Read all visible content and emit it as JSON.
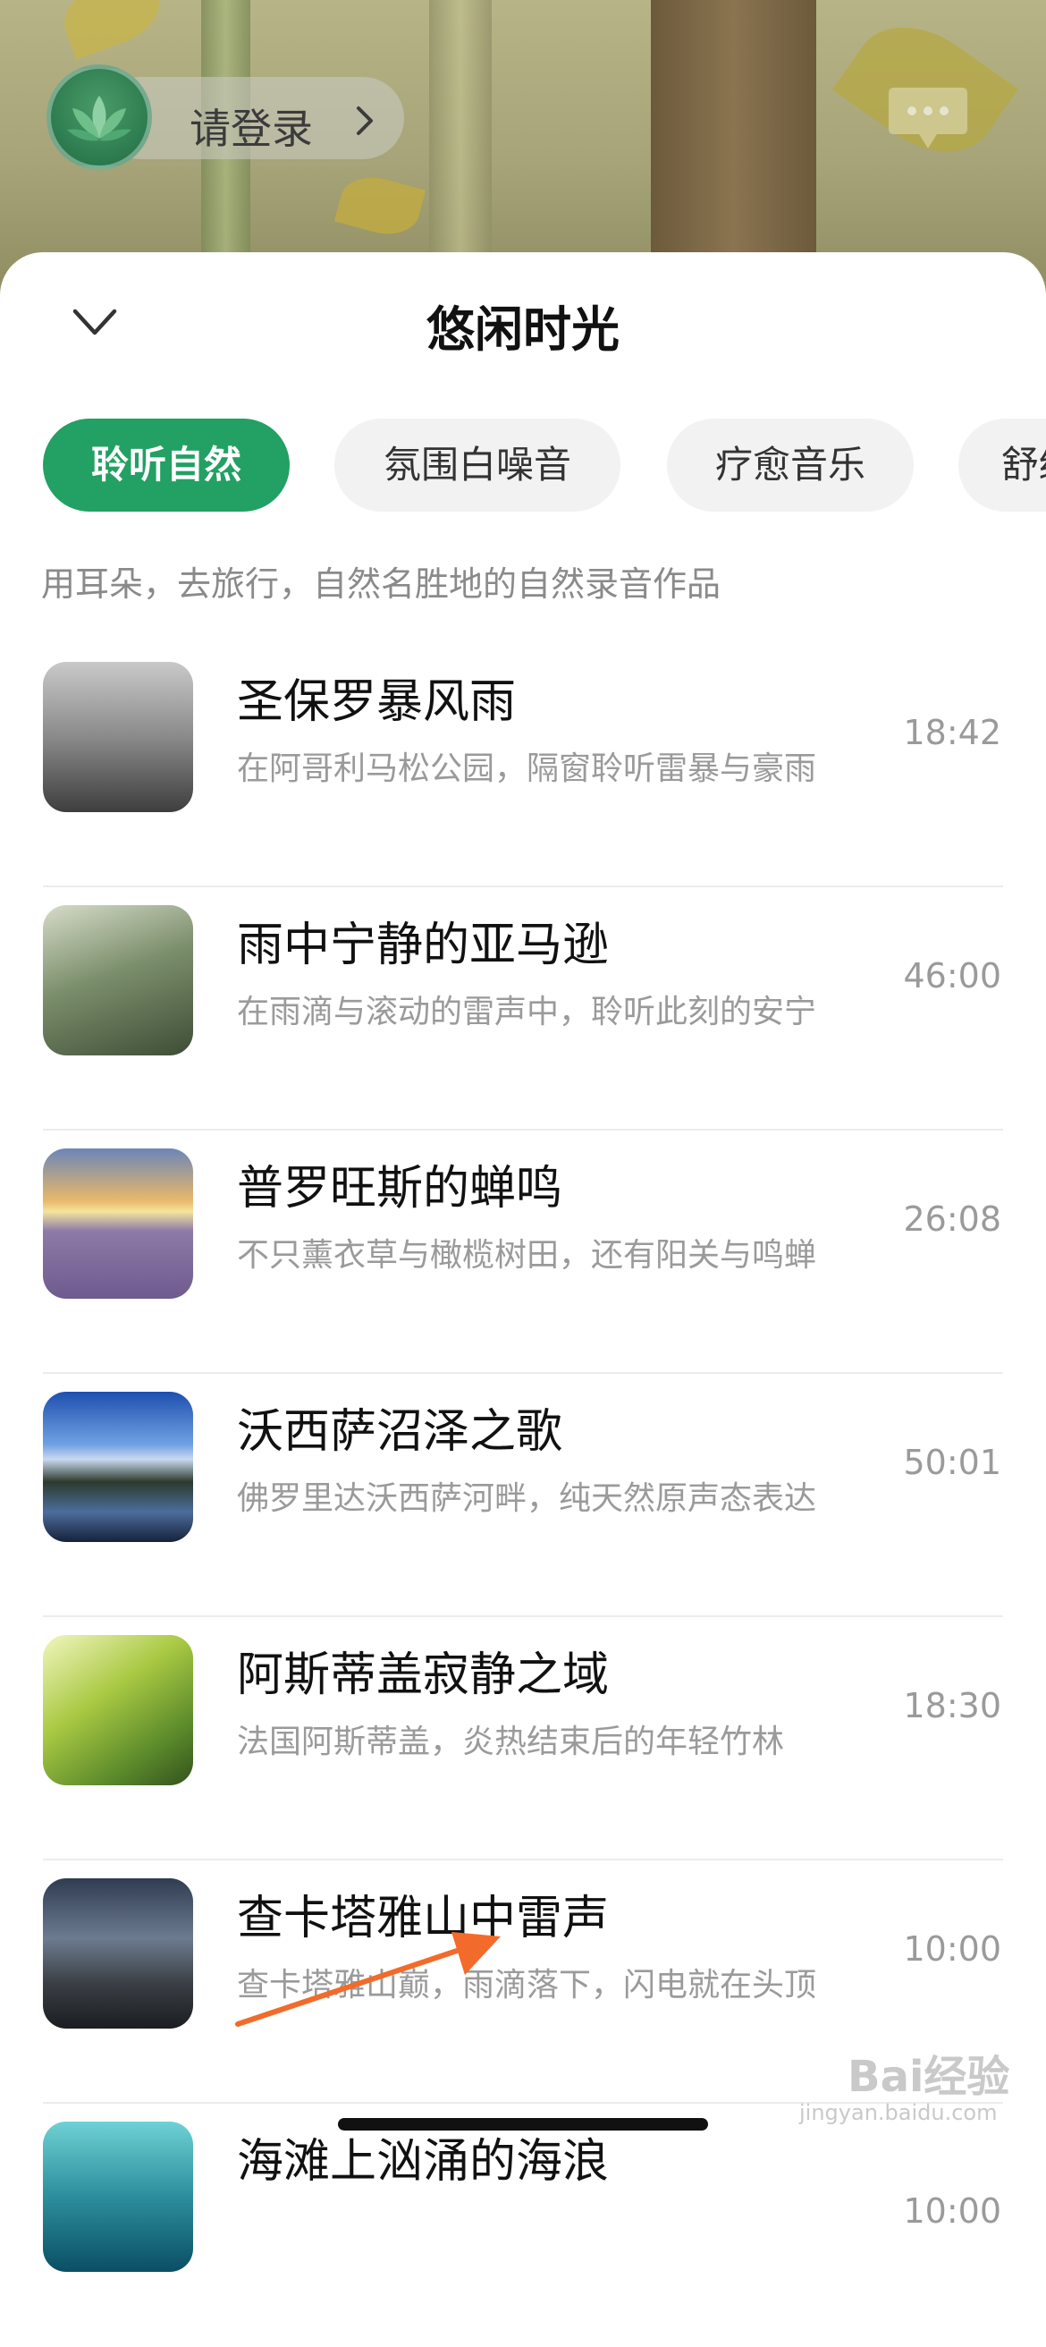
{
  "header": {
    "login_label": "请登录"
  },
  "sheet": {
    "title": "悠闲时光",
    "tabs": [
      {
        "label": "聆听自然",
        "active": true
      },
      {
        "label": "氛围白噪音",
        "active": false
      },
      {
        "label": "疗愈音乐",
        "active": false
      },
      {
        "label": "舒缓",
        "active": false
      }
    ],
    "subtitle": "用耳朵，去旅行，自然名胜地的自然录音作品"
  },
  "tracks": [
    {
      "title": "圣保罗暴风雨",
      "desc": "在阿哥利马松公园，隔窗聆听雷暴与豪雨",
      "duration": "18:42"
    },
    {
      "title": "雨中宁静的亚马逊",
      "desc": "在雨滴与滚动的雷声中，聆听此刻的安宁",
      "duration": "46:00"
    },
    {
      "title": "普罗旺斯的蝉鸣",
      "desc": "不只薰衣草与橄榄树田，还有阳关与鸣蝉",
      "duration": "26:08"
    },
    {
      "title": "沃西萨沼泽之歌",
      "desc": "佛罗里达沃西萨河畔，纯天然原声态表达",
      "duration": "50:01"
    },
    {
      "title": "阿斯蒂盖寂静之域",
      "desc": "法国阿斯蒂盖，炎热结束后的年轻竹林",
      "duration": "18:30"
    },
    {
      "title": "查卡塔雅山中雷声",
      "desc": "查卡塔雅山巅，雨滴落下，闪电就在头顶",
      "duration": "10:00"
    },
    {
      "title": "海滩上汹涌的海浪",
      "desc": "",
      "duration": "10:00"
    }
  ],
  "watermark": {
    "brand": "Bai经验",
    "url": "jingyan.baidu.com"
  },
  "colors": {
    "accent": "#23a063",
    "tab_bg": "#f2f2f2",
    "annotation_arrow": "#f26b2a"
  }
}
